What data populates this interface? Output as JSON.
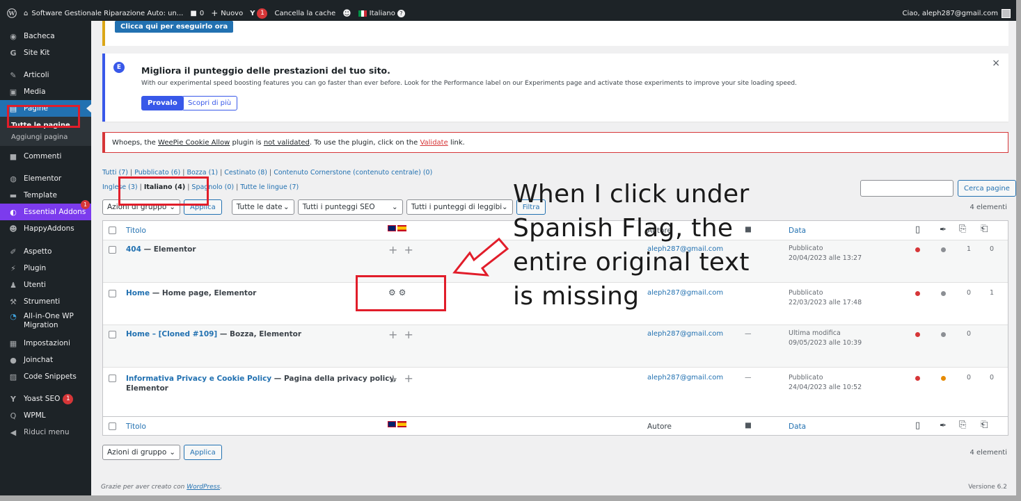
{
  "adminbar": {
    "site_title": "Software Gestionale Riparazione Auto: un...",
    "comments_count": "0",
    "new_label": "Nuovo",
    "yoast_badge": "1",
    "cache_label": "Cancella la cache",
    "language_label": "Italiano",
    "greeting": "Ciao, aleph287@gmail.com"
  },
  "sidebar": {
    "items": [
      {
        "icon": "dashboard-icon",
        "label": "Bacheca"
      },
      {
        "icon": "sitekit-icon",
        "label": "Site Kit"
      },
      {
        "icon": "pin-icon",
        "label": "Articoli"
      },
      {
        "icon": "media-icon",
        "label": "Media"
      },
      {
        "icon": "page-icon",
        "label": "Pagine"
      },
      {
        "icon": "comment-icon",
        "label": "Commenti"
      },
      {
        "icon": "elementor-icon",
        "label": "Elementor"
      },
      {
        "icon": "folder-icon",
        "label": "Template"
      },
      {
        "icon": "ea-icon",
        "label": "Essential Addons",
        "badge": "1"
      },
      {
        "icon": "happy-icon",
        "label": "HappyAddons"
      },
      {
        "icon": "brush-icon",
        "label": "Aspetto"
      },
      {
        "icon": "plugin-icon",
        "label": "Plugin"
      },
      {
        "icon": "users-icon",
        "label": "Utenti"
      },
      {
        "icon": "wrench-icon",
        "label": "Strumenti"
      },
      {
        "icon": "migration-icon",
        "label": "All-in-One WP Migration"
      },
      {
        "icon": "settings-icon",
        "label": "Impostazioni"
      },
      {
        "icon": "chat-icon",
        "label": "Joinchat"
      },
      {
        "icon": "code-icon",
        "label": "Code Snippets"
      },
      {
        "icon": "yoast-icon",
        "label": "Yoast SEO",
        "badge": "1"
      },
      {
        "icon": "wpml-icon",
        "label": "WPML"
      },
      {
        "icon": "collapse-icon",
        "label": "Riduci menu"
      }
    ],
    "submenu": [
      "Tutte le pagine",
      "Aggiungi pagina"
    ]
  },
  "notices": {
    "run_button": "Clicca qui per eseguirlo ora",
    "elementor_title": "Migliora il punteggio delle prestazioni del tuo sito.",
    "elementor_text": "With our experimental speed boosting features you can go faster than ever before. Look for the Performance label on our Experiments page and activate those experiments to improve your site loading speed.",
    "try_button": "Provalo",
    "learn_button": "Scopri di più",
    "wp_text_1": "Whoeps, the ",
    "wp_link_1": "WeePie Cookie Allow",
    "wp_text_2": " plugin is ",
    "wp_link_2": "not validated",
    "wp_text_3": ". To use the plugin, click on the ",
    "wp_link_3": "Validate",
    "wp_text_4": " link."
  },
  "filters": {
    "status_line": [
      "Tutti (7)",
      "Pubblicato (6)",
      "Bozza (1)",
      "Cestinato (8)",
      "Contenuto Cornerstone (contenuto centrale) (0)"
    ],
    "lang_line": [
      "Inglese (3)",
      "Italiano (4)",
      "Spagnolo (0)",
      "Tutte le lingue (7)"
    ],
    "bulk_action": "Azioni di gruppo",
    "apply": "Applica",
    "dates": "Tutte le date",
    "seo": "Tutti i punteggi SEO",
    "readability": "Tutti i punteggi di leggibilit",
    "filter_button": "Filtra",
    "search_button": "Cerca pagine",
    "search_value": "",
    "count": "4 elementi"
  },
  "table": {
    "headers": {
      "title": "Titolo",
      "author": "Autore",
      "date": "Data"
    },
    "rows": [
      {
        "title": "404",
        "suffix": " — Elementor",
        "translations": "++",
        "author": "aleph287@gmail.com",
        "comments": "—",
        "status": "Pubblicato",
        "date": "20/04/2023 alle 13:27",
        "seo_color": "#d63638",
        "read_color": "#8c8f94",
        "links_in": "1",
        "links_out": "0"
      },
      {
        "title": "Home",
        "suffix": " — Home page, Elementor",
        "translations": "gears",
        "author": "aleph287@gmail.com",
        "comments": "—",
        "status": "Pubblicato",
        "date": "22/03/2023 alle 17:48",
        "seo_color": "#d63638",
        "read_color": "#8c8f94",
        "links_in": "0",
        "links_out": "1"
      },
      {
        "title": "Home – [Cloned #109]",
        "suffix": " — Bozza, Elementor",
        "translations": "++",
        "author": "aleph287@gmail.com",
        "comments": "—",
        "status": "Ultima modifica",
        "date": "09/05/2023 alle 10:39",
        "seo_color": "#d63638",
        "read_color": "#8c8f94",
        "links_in": "0",
        "links_out": ""
      },
      {
        "title": "Informativa Privacy e Cookie Policy",
        "suffix": " — Pagina della privacy policy,",
        "suffix2": "Elementor",
        "translations": "++",
        "author": "aleph287@gmail.com",
        "comments": "—",
        "status": "Pubblicato",
        "date": "24/04/2023 alle 10:52",
        "seo_color": "#d63638",
        "read_color": "#e68a00",
        "links_in": "0",
        "links_out": "0"
      }
    ]
  },
  "bottom": {
    "bulk_action": "Azioni di gruppo",
    "apply": "Applica",
    "count": "4 elementi"
  },
  "footer": {
    "thanks_prefix": "Grazie per aver creato con ",
    "thanks_link": "WordPress",
    "thanks_suffix": ".",
    "version": "Versione 6.2"
  },
  "annotation": {
    "lines": [
      "When I click under",
      "Spanish Flag, the",
      "entire original text",
      "is missing"
    ]
  },
  "colors": {
    "accent": "#2271b1",
    "annotation_red": "#e11d2a",
    "sidebar_bg": "#1d2327"
  }
}
